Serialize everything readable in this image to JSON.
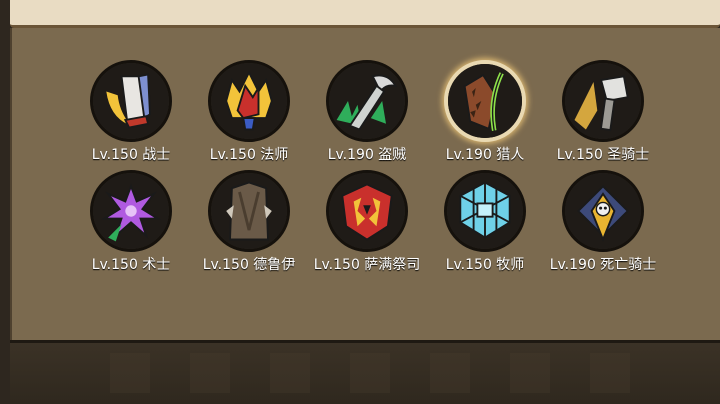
{
  "classes_row1": [
    {
      "label": "Lv.150 战士",
      "icon": "warrior-icon"
    },
    {
      "label": "Lv.150 法师",
      "icon": "mage-icon"
    },
    {
      "label": "Lv.190 盗贼",
      "icon": "rogue-icon"
    },
    {
      "label": "Lv.190 猎人",
      "icon": "hunter-icon",
      "selected": true
    },
    {
      "label": "Lv.150 圣骑士",
      "icon": "paladin-icon"
    }
  ],
  "classes_row2": [
    {
      "label": "Lv.150 术士",
      "icon": "warlock-icon"
    },
    {
      "label": "Lv.150 德鲁伊",
      "icon": "druid-icon"
    },
    {
      "label": "Lv.150 萨满祭司",
      "icon": "shaman-icon"
    },
    {
      "label": "Lv.150 牧师",
      "icon": "priest-icon"
    },
    {
      "label": "Lv.190 死亡骑士",
      "icon": "death-knight-icon"
    }
  ],
  "colors": {
    "panel": "#7b6a4f",
    "header": "#e9dcc3",
    "footer": "#3b3226",
    "label": "#ffffff",
    "selected_ring": "#e9d9b2"
  }
}
